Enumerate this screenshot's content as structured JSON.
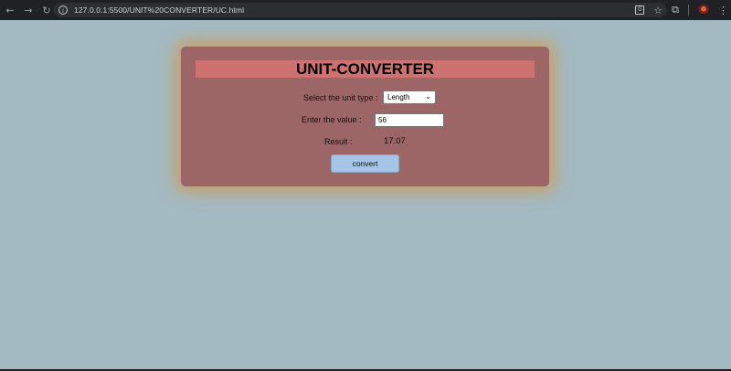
{
  "browser": {
    "url": "127.0.0.1:5500/UNIT%20CONVERTER/UC.html",
    "back_icon": "←",
    "forward_icon": "→",
    "reload_icon": "↻",
    "info_icon": "i",
    "translate_icon": "G",
    "star_icon": "☆",
    "extensions_icon": "⧉",
    "menu_icon": "⋮"
  },
  "converter": {
    "title": "UNIT-CONVERTER",
    "unit_label": "Select the unit type :",
    "unit_selected": "Length",
    "value_label": "Enter the value :",
    "value": "56",
    "result_label": "Result :",
    "result_value": "17.07",
    "convert_label": "convert"
  },
  "colors": {
    "page_bg": "#a3bac3",
    "card_bg": "#9b6665",
    "title_bg": "#cd7171",
    "button_bg": "#a6c4e6",
    "glow": "#d69646"
  }
}
